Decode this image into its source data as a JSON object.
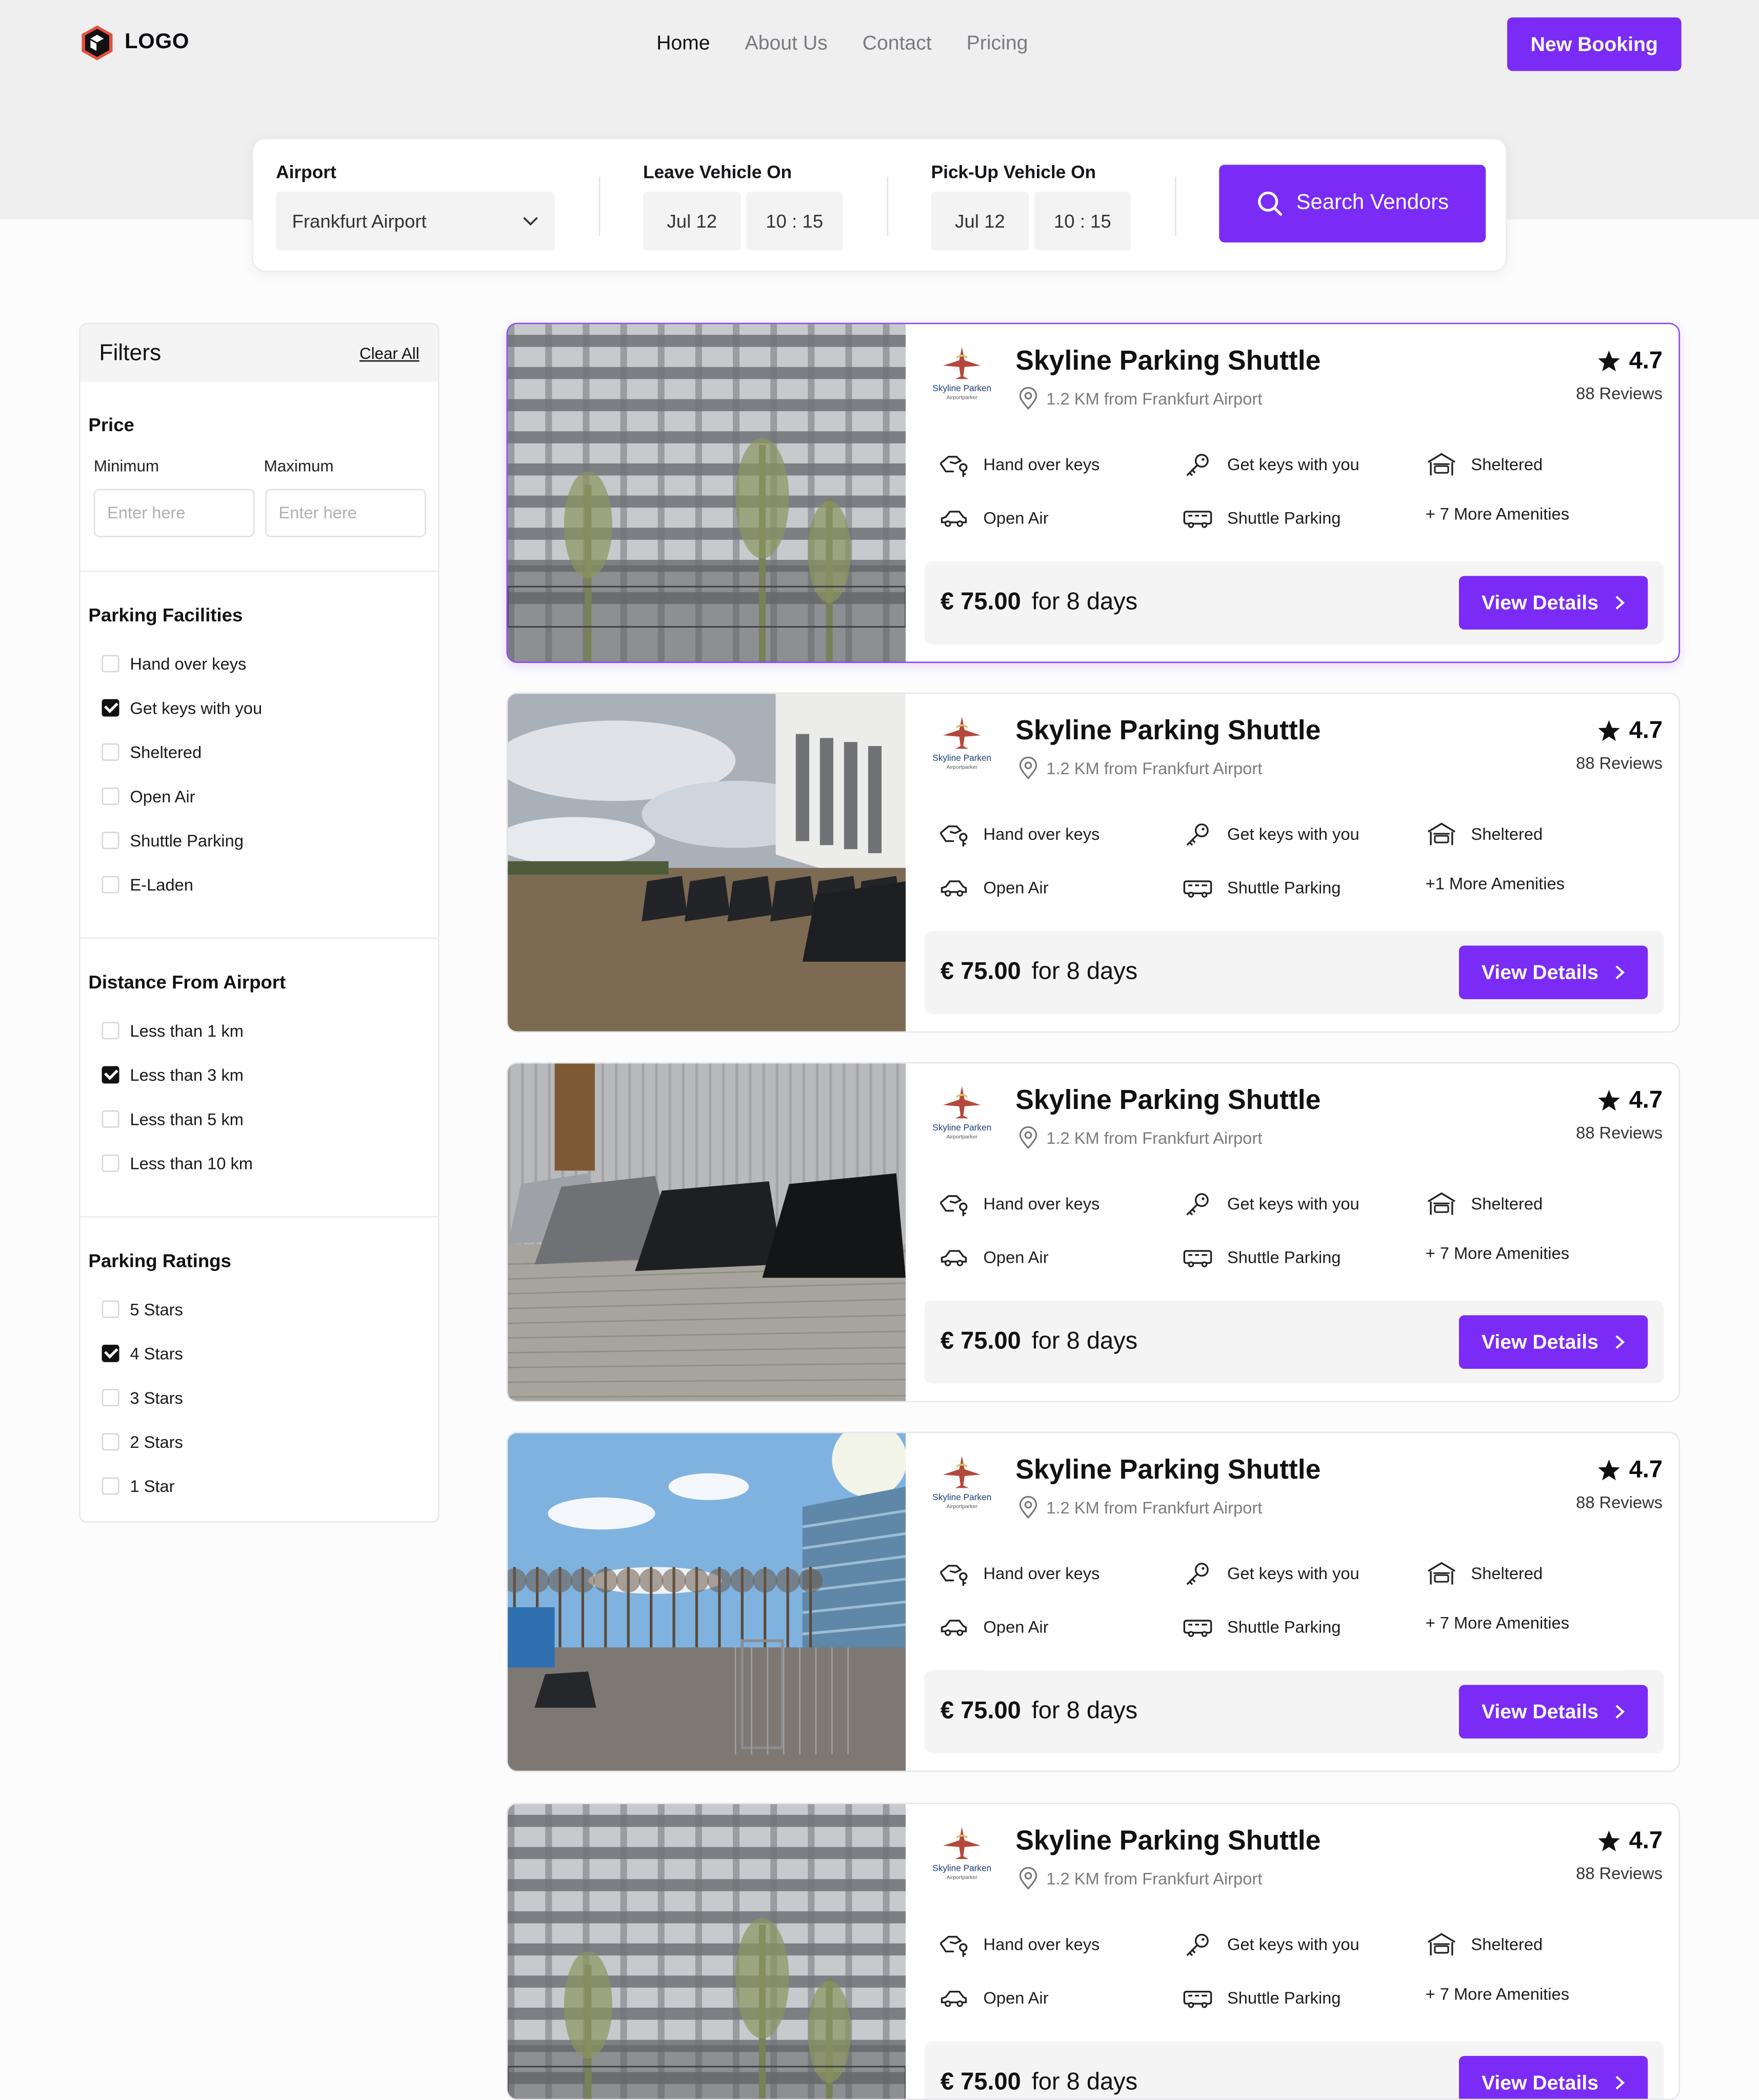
{
  "header": {
    "logo_text": "LOGO",
    "nav": [
      {
        "label": "Home",
        "active": true
      },
      {
        "label": "About Us",
        "active": false
      },
      {
        "label": "Contact",
        "active": false
      },
      {
        "label": "Pricing",
        "active": false
      }
    ],
    "new_booking": "New Booking"
  },
  "search": {
    "airport_label": "Airport",
    "airport_value": "Frankfurt Airport",
    "leave_label": "Leave Vehicle On",
    "leave_date": "Jul 12",
    "leave_time": "10 : 15",
    "pickup_label": "Pick-Up Vehicle On",
    "pickup_date": "Jul 12",
    "pickup_time": "10 : 15",
    "button": "Search Vendors"
  },
  "filters": {
    "title": "Filters",
    "clear": "Clear All",
    "price": {
      "title": "Price",
      "min_label": "Minimum",
      "max_label": "Maximum",
      "min_placeholder": "Enter here",
      "max_placeholder": "Enter here"
    },
    "facilities": {
      "title": "Parking Facilities",
      "items": [
        {
          "label": "Hand over keys",
          "checked": false
        },
        {
          "label": "Get keys with you",
          "checked": true
        },
        {
          "label": "Sheltered",
          "checked": false
        },
        {
          "label": "Open Air",
          "checked": false
        },
        {
          "label": "Shuttle Parking",
          "checked": false
        },
        {
          "label": "E-Laden",
          "checked": false
        }
      ]
    },
    "distance": {
      "title": "Distance From Airport",
      "items": [
        {
          "label": "Less than 1 km",
          "checked": false
        },
        {
          "label": "Less than 3 km",
          "checked": true
        },
        {
          "label": "Less than 5 km",
          "checked": false
        },
        {
          "label": "Less than 10 km",
          "checked": false
        }
      ]
    },
    "ratings": {
      "title": "Parking Ratings",
      "items": [
        {
          "label": "5 Stars",
          "checked": false
        },
        {
          "label": "4 Stars",
          "checked": true
        },
        {
          "label": "3 Stars",
          "checked": false
        },
        {
          "label": "2 Stars",
          "checked": false
        },
        {
          "label": "1 Star",
          "checked": false
        }
      ]
    }
  },
  "listings": [
    {
      "name": "Skyline Parking Shuttle",
      "distance": "1.2 KM from Frankfurt Airport",
      "rating": "4.7",
      "reviews": "88 Reviews",
      "amenities": [
        "Hand over keys",
        "Get keys with you",
        "Sheltered",
        "Open Air",
        "Shuttle Parking",
        "+ 7 More Amenities"
      ],
      "price": "€ 75.00",
      "duration": "for 8 days",
      "button": "View Details",
      "vendor_logo_text": "Skyline Parken",
      "vendor_logo_sub": "Airportparker",
      "photo": "garage",
      "selected": true
    },
    {
      "name": "Skyline Parking Shuttle",
      "distance": "1.2 KM from Frankfurt Airport",
      "rating": "4.7",
      "reviews": "88 Reviews",
      "amenities": [
        "Hand over keys",
        "Get keys with you",
        "Sheltered",
        "Open Air",
        "Shuttle Parking",
        "+1 More Amenities"
      ],
      "price": "€ 75.00",
      "duration": "for 8 days",
      "button": "View Details",
      "vendor_logo_text": "Skyline Parken",
      "vendor_logo_sub": "Airportparker",
      "photo": "lot-cloudy",
      "selected": false
    },
    {
      "name": "Skyline Parking Shuttle",
      "distance": "1.2 KM from Frankfurt Airport",
      "rating": "4.7",
      "reviews": "88 Reviews",
      "amenities": [
        "Hand over keys",
        "Get keys with you",
        "Sheltered",
        "Open Air",
        "Shuttle Parking",
        "+ 7 More Amenities"
      ],
      "price": "€ 75.00",
      "duration": "for 8 days",
      "button": "View Details",
      "vendor_logo_text": "Skyline Parken",
      "vendor_logo_sub": "Airportparker",
      "photo": "cars-paving",
      "selected": false
    },
    {
      "name": "Skyline Parking Shuttle",
      "distance": "1.2 KM from Frankfurt Airport",
      "rating": "4.7",
      "reviews": "88 Reviews",
      "amenities": [
        "Hand over keys",
        "Get keys with you",
        "Sheltered",
        "Open Air",
        "Shuttle Parking",
        "+ 7 More Amenities"
      ],
      "price": "€ 75.00",
      "duration": "for 8 days",
      "button": "View Details",
      "vendor_logo_text": "Skyline Parken",
      "vendor_logo_sub": "Airportparker",
      "photo": "open-sky",
      "selected": false
    },
    {
      "name": "Skyline Parking Shuttle",
      "distance": "1.2 KM from Frankfurt Airport",
      "rating": "4.7",
      "reviews": "88 Reviews",
      "amenities": [
        "Hand over keys",
        "Get keys with you",
        "Sheltered",
        "Open Air",
        "Shuttle Parking",
        "+ 7 More Amenities"
      ],
      "price": "€ 75.00",
      "duration": "for 8 days",
      "button": "View Details",
      "vendor_logo_text": "Skyline Parken",
      "vendor_logo_sub": "Airportparker",
      "photo": "garage",
      "selected": false
    }
  ],
  "colors": {
    "accent": "#7a2bf5",
    "hero_bg": "#efeff0",
    "page_bg": "#fcfcfd"
  }
}
